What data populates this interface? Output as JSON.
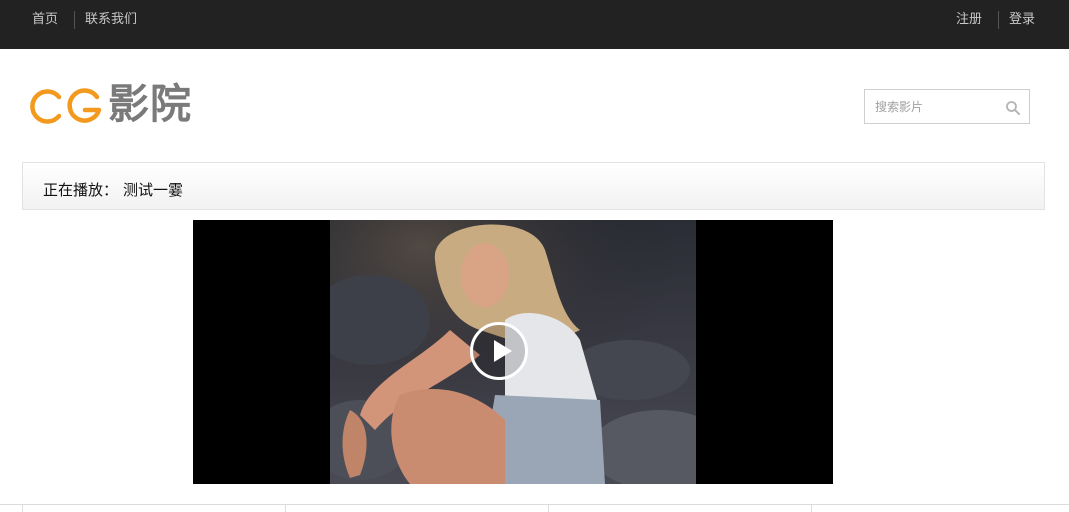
{
  "topnav": {
    "left": [
      {
        "label": "首页"
      },
      {
        "label": "联系我们"
      }
    ],
    "right": [
      {
        "label": "注册"
      },
      {
        "label": "登录"
      }
    ]
  },
  "logo": {
    "latin": "CG",
    "chinese": "影院",
    "accent_color": "#f39a1e",
    "text_color": "#7a7a7a"
  },
  "search": {
    "placeholder": "搜索影片",
    "icon": "search-icon"
  },
  "now_playing": {
    "label": "正在播放：",
    "title": "测试一霎"
  },
  "player": {
    "play_icon": "play-icon"
  }
}
